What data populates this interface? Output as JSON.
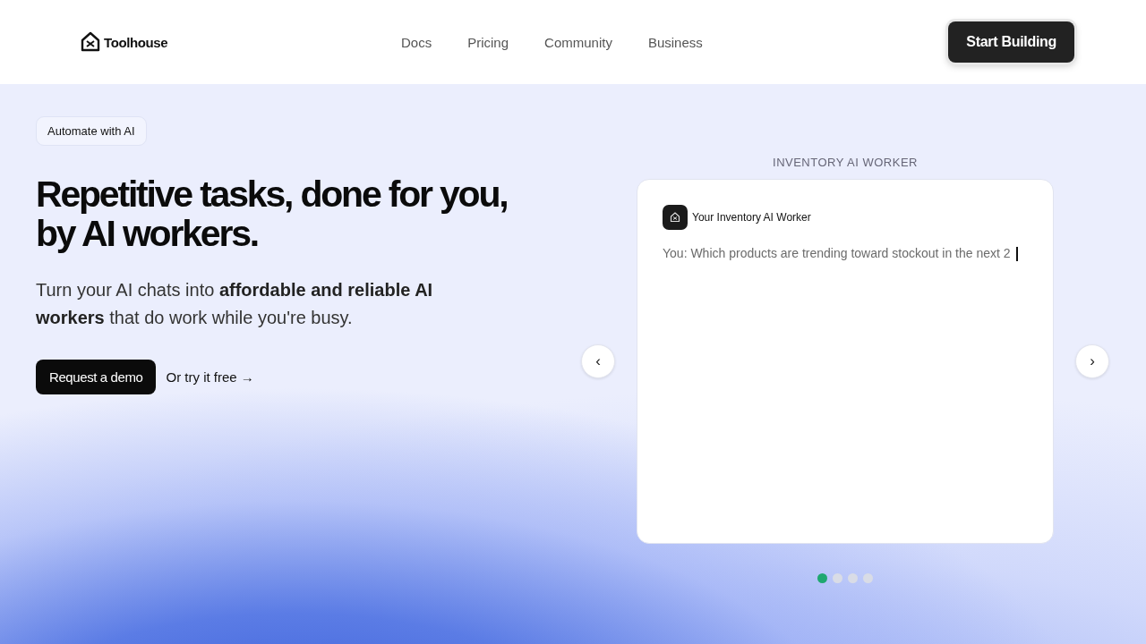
{
  "header": {
    "brand": "Toolhouse",
    "nav": [
      "Docs",
      "Pricing",
      "Community",
      "Business"
    ],
    "cta": "Start Building"
  },
  "hero": {
    "badge": "Automate with AI",
    "title": "Repetitive tasks, done for you, by AI workers.",
    "subtitle": "Turn your AI chats into **affordable and reliable AI workers** that do work while you're busy.",
    "primary_button": "Request a demo",
    "secondary_link": "Or try it free →"
  },
  "carousel": {
    "label": "INVENTORY AI WORKER",
    "prev": "‹",
    "next": "›",
    "worker_name": "Your Inventory AI Worker",
    "message": "You: Which products are trending toward stockout in the next 2",
    "typing": true,
    "dots": [
      {
        "selected": true
      },
      {
        "selected": false
      },
      {
        "selected": false
      },
      {
        "selected": false
      }
    ]
  }
}
